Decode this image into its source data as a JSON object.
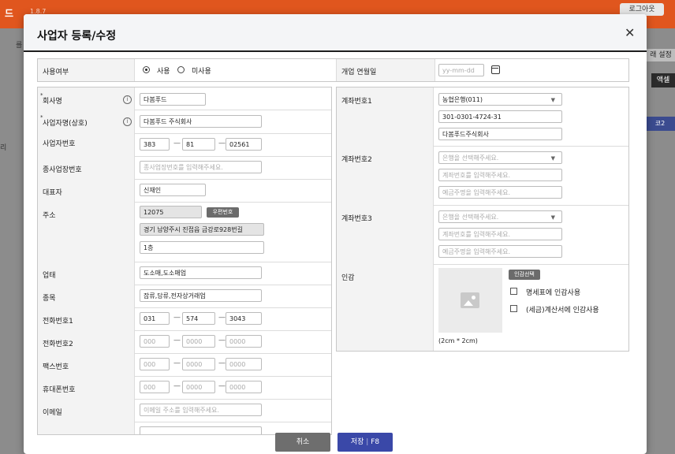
{
  "background": {
    "logo": "드",
    "version": "1.8.7",
    "logout": "로그아웃",
    "left_label_top": "를",
    "left_label_mid": "리",
    "right_setting": "래 설정",
    "right_excel": "액셀",
    "right_tag": "코2"
  },
  "modal": {
    "title": "사업자 등록/수정",
    "close_icon": "close-icon",
    "usage": {
      "label": "사용여부",
      "opt_use": "사용",
      "opt_nouse": "미사용",
      "selected": "사용"
    },
    "open_date": {
      "label": "개업 연월일",
      "placeholder": "yy-mm-dd"
    },
    "left": {
      "company": {
        "label": "회사명",
        "value": "다봄푸드"
      },
      "biz_name": {
        "label": "사업자명(상호)",
        "value": "다봄푸드 주식회사"
      },
      "biz_no": {
        "label": "사업자번호",
        "p1": "383",
        "p2": "81",
        "p3": "02561"
      },
      "sub_biz": {
        "label": "종사업장번호",
        "placeholder": "종사업장번호를 입력해주세요."
      },
      "ceo": {
        "label": "대표자",
        "value": "신재인"
      },
      "address": {
        "label": "주소",
        "zip": "12075",
        "zip_btn": "우편번호",
        "addr1": "경기 남양주시 진접읍 금강로928번길",
        "addr2": "1층"
      },
      "biz_type": {
        "label": "업태",
        "value": "도소매,도소매업"
      },
      "biz_item": {
        "label": "종목",
        "value": "잡류,담류,전자상거래업"
      },
      "phone1": {
        "label": "전화번호1",
        "p1": "031",
        "p2": "574",
        "p3": "3043"
      },
      "phone2": {
        "label": "전화번호2",
        "p1": "000",
        "p2": "0000",
        "p3": "0000"
      },
      "fax": {
        "label": "팩스번호",
        "p1": "000",
        "p2": "0000",
        "p3": "0000"
      },
      "mobile": {
        "label": "휴대폰번호",
        "p1": "000",
        "p2": "0000",
        "p3": "0000"
      },
      "email": {
        "label": "이메일",
        "placeholder": "이메일 주소를 입력해주세요."
      }
    },
    "right": {
      "account1": {
        "label": "계좌번호1",
        "bank": "농협은행(011)",
        "number": "301-0301-4724-31",
        "holder": "다봄푸드주식회사"
      },
      "account2": {
        "label": "계좌번호2",
        "bank_ph": "은행을 선택해주세요.",
        "number_ph": "계좌번호를 입력해주세요.",
        "holder_ph": "예금주명을 입력해주세요."
      },
      "account3": {
        "label": "계좌번호3",
        "bank_ph": "은행을 선택해주세요.",
        "number_ph": "계좌번호를 입력해주세요.",
        "holder_ph": "예금주명을 입력해주세요."
      },
      "seal": {
        "label": "인감",
        "btn": "인감선택",
        "chk1": "명세표에 인감사용",
        "chk2": "(세금)계산서에 인감사용",
        "size": "(2cm * 2cm)"
      }
    },
    "footer": {
      "cancel": "취소",
      "save": "저장",
      "save_key": "F8"
    }
  },
  "colors": {
    "header": "#e0561e",
    "save_btn": "#3a48a8",
    "cancel_btn": "#6e6e6e"
  }
}
